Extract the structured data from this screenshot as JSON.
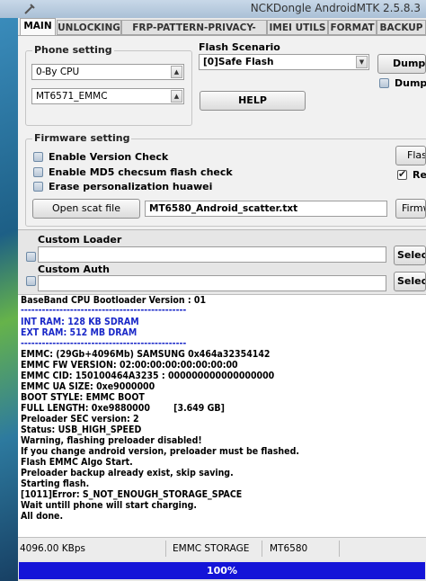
{
  "window": {
    "title": "NCKDongle AndroidMTK 2.5.8.3"
  },
  "tabs": [
    "MAIN",
    "UNLOCKING",
    "FRP-PATTERN-PRIVACY-RESET",
    "IMEI UTILS",
    "FORMAT",
    "BACKUP"
  ],
  "phone_setting": {
    "label": "Phone setting",
    "cpu": "0-By CPU",
    "model": "MT6571_EMMC"
  },
  "flash_scenario": {
    "label": "Flash Scenario",
    "value": "[0]Safe Flash"
  },
  "buttons": {
    "help": "HELP",
    "dump": "Dump t",
    "flash": "Flas",
    "firmware": "Firmw",
    "open_scat": "Open scat file",
    "select1": "Select",
    "select2": "Selec"
  },
  "dump_check_label": "Dump",
  "re_check_label": "Re",
  "firmware": {
    "label": "Firmware setting",
    "checks": [
      "Enable Version Check",
      "Enable MD5 checsum flash check",
      "Erase personalization huawei"
    ],
    "scatter_file": "MT6580_Android_scatter.txt"
  },
  "custom_loader": {
    "label": "Custom Loader",
    "value": ""
  },
  "custom_auth": {
    "label": "Custom Auth",
    "value": ""
  },
  "log": [
    "BaseBand CPU Bootloader Version : 01",
    "-----------------------------------------------",
    "INT RAM: 128 KB SDRAM",
    "EXT RAM: 512 MB  DRAM",
    "-----------------------------------------------",
    "EMMC: (29Gb+4096Mb) SAMSUNG 0x464a32354142",
    "EMMC FW VERSION: 02:00:00:00:00:00:00:00",
    "EMMC CID: 150100464A3235 : 000000000000000000",
    "EMMC UA SIZE: 0xe9000000",
    "BOOT STYLE: EMMC BOOT",
    "FULL LENGTH: 0xe9880000        [3.649 GB]",
    "Preloader SEC version: 2",
    "Status: USB_HIGH_SPEED",
    "Warning, flashing preloader disabled!",
    "If you change android version, preloader must be flashed.",
    "Flash EMMC Algo Start.",
    "Preloader backup already exist, skip saving.",
    "Starting flash.",
    "[1011]Error: S_NOT_ENOUGH_STORAGE_SPACE",
    "Wait untill phone will start charging.",
    "All done."
  ],
  "status": {
    "speed": "4096.00 KBps",
    "storage": "EMMC STORAGE",
    "chip": "MT6580"
  },
  "progress": {
    "text": "100%",
    "fraction": 1.0
  },
  "colors": {
    "progress": "#1414d8",
    "log_blue": "#1a28c8"
  }
}
